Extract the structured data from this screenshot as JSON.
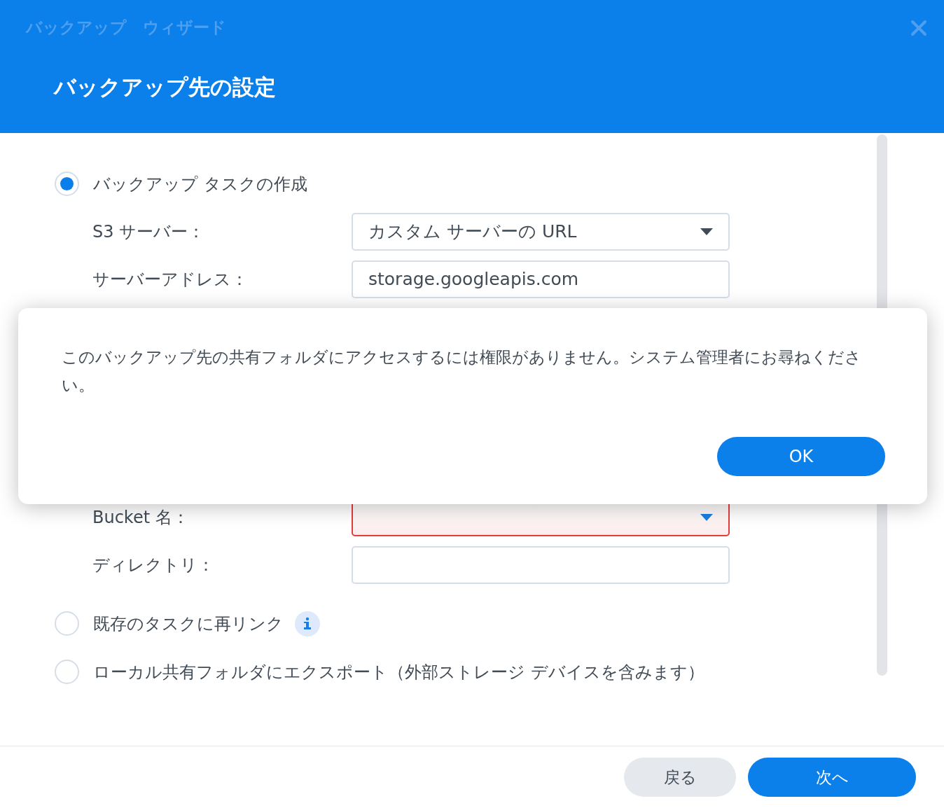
{
  "window": {
    "title": "バックアップ　ウィザード"
  },
  "heading": "バックアップ先の設定",
  "options": [
    {
      "label": "バックアップ タスクの作成",
      "selected": true,
      "info": false,
      "fields": [
        {
          "label": "S3 サーバー：",
          "kind": "select",
          "value": "カスタム サーバーの URL",
          "error": false
        },
        {
          "label": "サーバーアドレス：",
          "kind": "text",
          "value": "storage.googleapis.com",
          "error": false
        },
        {
          "label": "Bucket 名：",
          "kind": "select",
          "error": true
        },
        {
          "label": "ディレクトリ：",
          "kind": "text",
          "error": false
        }
      ]
    },
    {
      "label": "既存のタスクに再リンク",
      "selected": false,
      "info": true
    },
    {
      "label": "ローカル共有フォルダにエクスポート（外部ストレージ デバイスを含みます）",
      "selected": false,
      "info": false
    }
  ],
  "alert": {
    "message": "このバックアップ先の共有フォルダにアクセスするには権限がありません。システム管理者にお尋ねください。",
    "button": "OK"
  },
  "buttons": [
    {
      "label": "戻る",
      "kind": "secondary"
    },
    {
      "label": "次へ",
      "kind": "primary"
    }
  ]
}
